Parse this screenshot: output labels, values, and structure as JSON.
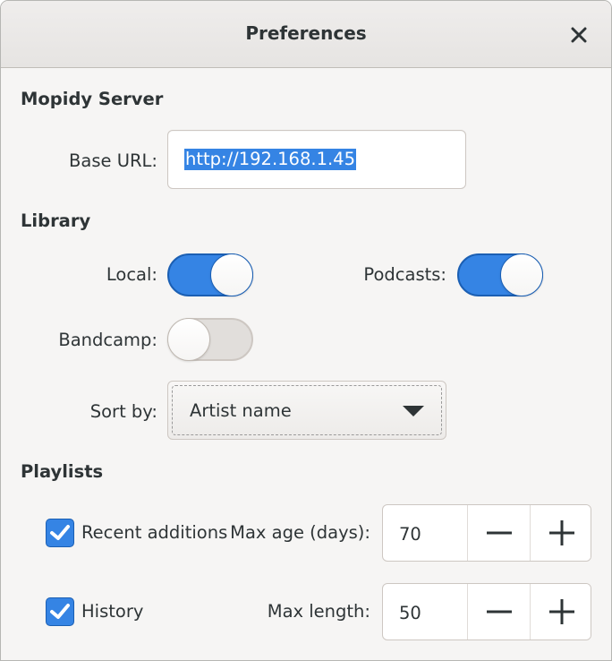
{
  "window": {
    "title": "Preferences"
  },
  "server": {
    "heading": "Mopidy Server",
    "base_url_label": "Base URL:",
    "base_url_value": "http://192.168.1.45"
  },
  "library": {
    "heading": "Library",
    "local_label": "Local:",
    "local_enabled": true,
    "podcasts_label": "Podcasts:",
    "podcasts_enabled": true,
    "bandcamp_label": "Bandcamp:",
    "bandcamp_enabled": false,
    "sort_label": "Sort by:",
    "sort_value": "Artist name"
  },
  "playlists": {
    "heading": "Playlists",
    "recent_label": "Recent additions",
    "recent_checked": true,
    "max_age_label": "Max age (days):",
    "max_age_value": "70",
    "history_label": "History",
    "history_checked": true,
    "max_length_label": "Max length:",
    "max_length_value": "50"
  },
  "colors": {
    "accent": "#3584e4",
    "window_bg": "#f6f5f4",
    "text": "#2e3436"
  },
  "icons": {
    "close": "close-icon",
    "dropdown": "chevron-down-icon",
    "minus": "minus-icon",
    "plus": "plus-icon",
    "check": "check-icon"
  }
}
